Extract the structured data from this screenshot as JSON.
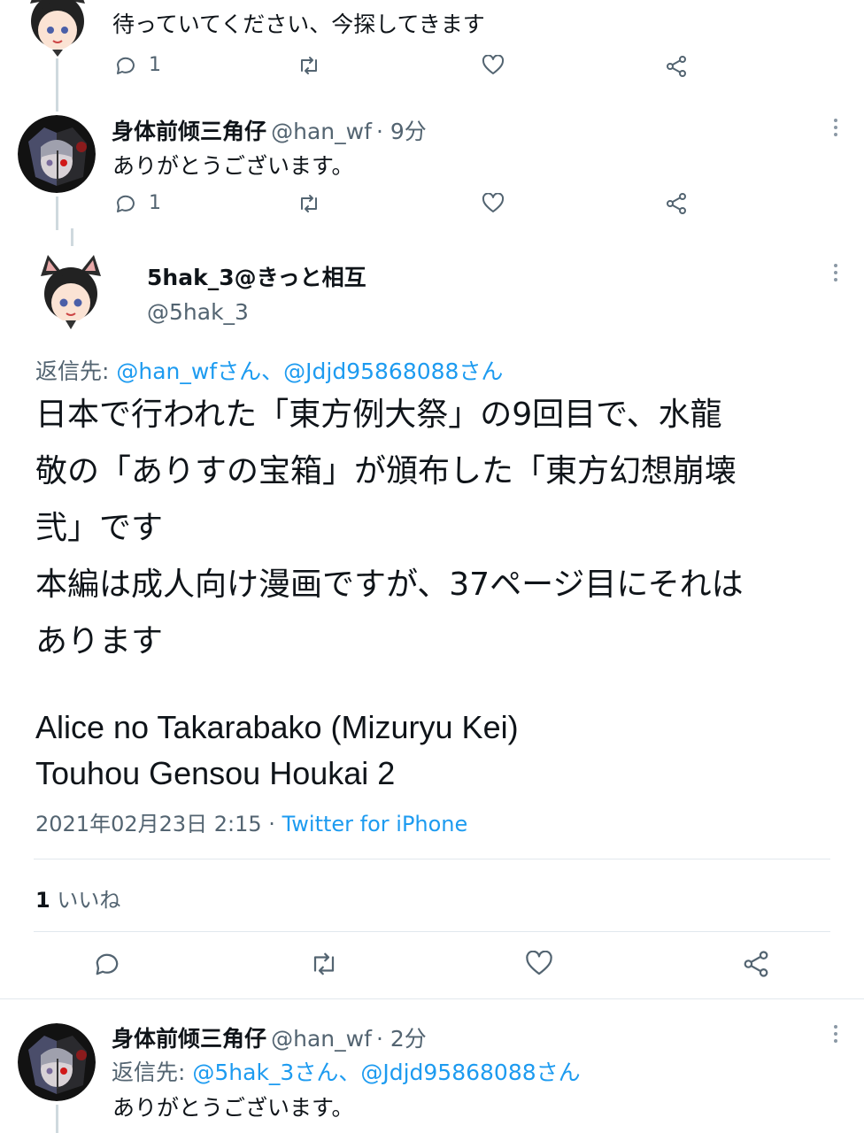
{
  "tweets": [
    {
      "body": "待っていてください、今探してきます",
      "reply_count": "1"
    },
    {
      "name": "身体前倾三角仔",
      "handle": "@han_wf",
      "time": "· 9分",
      "body": "ありがとうございます。",
      "reply_count": "1"
    }
  ],
  "main_tweet": {
    "name": "5hak_3@きっと相互",
    "handle": "@5hak_3",
    "reply_prefix": "返信先: ",
    "reply_targets": "@han_wfさん、@Jdjd95868088さん",
    "lines": [
      "日本で行われた「東方例大祭」の9回目で、水龍",
      "敬の「ありすの宝箱」が頒布した「東方幻想崩壊",
      "弐」です",
      "本編は成人向け漫画ですが、37ページ目にそれは",
      "あります",
      "",
      "Alice no Takarabako (Mizuryu Kei)",
      "Touhou Gensou Houkai 2"
    ],
    "timestamp": "2021年02月23日 2:15 · ",
    "source": "Twitter for iPhone",
    "likes_count": "1",
    "likes_label": "いいね"
  },
  "reply_tweet": {
    "name": "身体前倾三角仔",
    "handle": "@han_wf",
    "time": "· 2分",
    "reply_prefix": "返信先: ",
    "reply_targets": "@5hak_3さん、@Jdjd95868088さん",
    "body": "ありがとうございます。"
  },
  "colors": {
    "accent": "#1d9bf0",
    "secondary_text": "#536471",
    "divider": "#e1e8ed"
  }
}
